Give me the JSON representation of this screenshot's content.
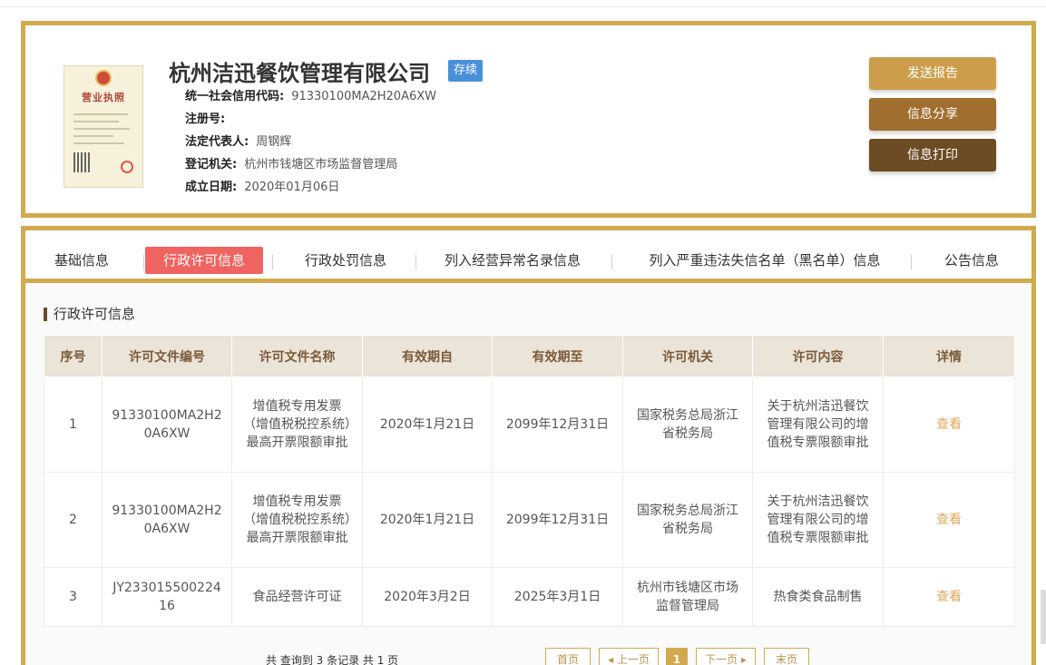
{
  "company": {
    "name": "杭州洁迅餐饮管理有限公司",
    "status": "存续",
    "license_image": {
      "title": "营业执照"
    },
    "fields": [
      {
        "label": "统一社会信用代码:",
        "value": "91330100MA2H20A6XW"
      },
      {
        "label": "注册号:",
        "value": ""
      },
      {
        "label": "法定代表人:",
        "value": "周钢辉"
      },
      {
        "label": "登记机关:",
        "value": "杭州市钱塘区市场监督管理局"
      },
      {
        "label": "成立日期:",
        "value": "2020年01月06日"
      }
    ]
  },
  "actions": {
    "send_report": "发送报告",
    "share": "信息分享",
    "print": "信息打印"
  },
  "tabs": [
    {
      "label": "基础信息",
      "active": false
    },
    {
      "label": "行政许可信息",
      "active": true
    },
    {
      "label": "行政处罚信息",
      "active": false
    },
    {
      "label": "列入经营异常名录信息",
      "active": false
    },
    {
      "label": "列入严重违法失信名单（黑名单）信息",
      "active": false
    },
    {
      "label": "公告信息",
      "active": false
    }
  ],
  "section_title": "行政许可信息",
  "table": {
    "headers": [
      "序号",
      "许可文件编号",
      "许可文件名称",
      "有效期自",
      "有效期至",
      "许可机关",
      "许可内容",
      "详情"
    ],
    "rows": [
      [
        "1",
        "91330100MA2H20A6XW",
        "增值税专用发票（增值税税控系统）最高开票限额审批",
        "2020年1月21日",
        "2099年12月31日",
        "国家税务总局浙江省税务局",
        "关于杭州洁迅餐饮管理有限公司的增值税专票限额审批",
        "查看"
      ],
      [
        "2",
        "91330100MA2H20A6XW",
        "增值税专用发票（增值税税控系统）最高开票限额审批",
        "2020年1月21日",
        "2099年12月31日",
        "国家税务总局浙江省税务局",
        "关于杭州洁迅餐饮管理有限公司的增值税专票限额审批",
        "查看"
      ],
      [
        "3",
        "JY23301550022416",
        "食品经营许可证",
        "2020年3月2日",
        "2025年3月1日",
        "杭州市钱塘区市场监督管理局",
        "热食类食品制售",
        "查看"
      ]
    ]
  },
  "pagination": {
    "summary": "共 查询到 3 条记录 共 1 页",
    "first": "首页",
    "prev": "◂ 上一页",
    "current": "1",
    "next": "下一页 ▸",
    "last": "末页"
  },
  "colors": {
    "gold_border": "#d2aa4d",
    "status_blue": "#4a90d9",
    "active_tab": "#ef6460",
    "btn_send": "#cc9e4c",
    "btn_share": "#a06e2f",
    "btn_print": "#6b4c23",
    "view_link": "#e3a85c"
  }
}
